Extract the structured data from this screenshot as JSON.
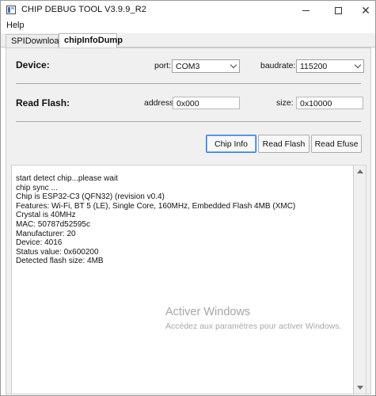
{
  "window": {
    "title": "CHIP DEBUG TOOL V3.9.9_R2",
    "app_icon": "app-window-icon",
    "controls": {
      "minimize": "minimize-icon",
      "maximize": "maximize-icon",
      "close": "close-icon"
    }
  },
  "menu": {
    "help": "Help"
  },
  "tabs": [
    {
      "label": "SPIDownload",
      "active": false
    },
    {
      "label": "chipInfoDump",
      "active": true
    }
  ],
  "device": {
    "section_label": "Device:",
    "port_label": "port:",
    "port_value": "COM3",
    "baudrate_label": "baudrate:",
    "baudrate_value": "115200"
  },
  "read_flash": {
    "section_label": "Read Flash:",
    "address_label": "address:",
    "address_value": "0x000",
    "size_label": "size:",
    "size_value": "0x10000"
  },
  "buttons": {
    "chip_info": "Chip Info",
    "read_flash": "Read Flash",
    "read_efuse": "Read Efuse"
  },
  "log": {
    "lines": [
      "start detect chip...please wait",
      "chip sync ...",
      "Chip is ESP32-C3 (QFN32) (revision v0.4)",
      "Features: Wi-Fi, BT 5 (LE), Single Core, 160MHz, Embedded Flash 4MB (XMC)",
      "Crystal is 40MHz",
      "MAC: 50787d52595c",
      "Manufacturer: 20",
      "Device: 4016",
      "Status value: 0x600200",
      "Detected flash size: 4MB"
    ]
  },
  "watermark": {
    "title": "Activer Windows",
    "subtitle": "Accédez aux paramètres pour activer Windows."
  },
  "colors": {
    "accent_border": "#2f7ad8",
    "panel_bg": "#f0f0f0",
    "watermark_text": "#a6a6a6"
  }
}
